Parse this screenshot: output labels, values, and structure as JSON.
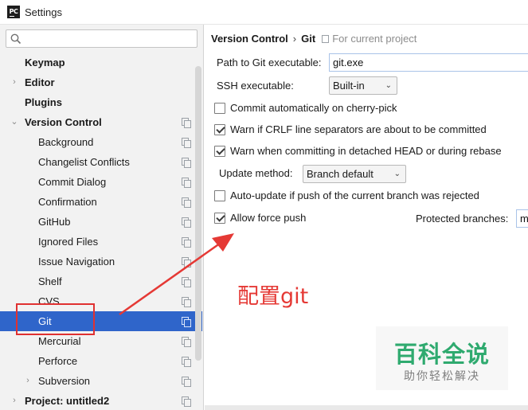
{
  "window": {
    "title": "Settings",
    "app_icon_text": "PC"
  },
  "search": {
    "placeholder": ""
  },
  "tree": [
    {
      "label": "Keymap",
      "bold": true,
      "arrow": "",
      "indent": 0,
      "copy": false,
      "selected": false
    },
    {
      "label": "Editor",
      "bold": true,
      "arrow": "›",
      "indent": 0,
      "copy": false,
      "selected": false
    },
    {
      "label": "Plugins",
      "bold": true,
      "arrow": "",
      "indent": 0,
      "copy": false,
      "selected": false
    },
    {
      "label": "Version Control",
      "bold": true,
      "arrow": "⌄",
      "indent": 0,
      "copy": true,
      "selected": false
    },
    {
      "label": "Background",
      "bold": false,
      "arrow": "",
      "indent": 1,
      "copy": true,
      "selected": false
    },
    {
      "label": "Changelist Conflicts",
      "bold": false,
      "arrow": "",
      "indent": 1,
      "copy": true,
      "selected": false
    },
    {
      "label": "Commit Dialog",
      "bold": false,
      "arrow": "",
      "indent": 1,
      "copy": true,
      "selected": false
    },
    {
      "label": "Confirmation",
      "bold": false,
      "arrow": "",
      "indent": 1,
      "copy": true,
      "selected": false
    },
    {
      "label": "GitHub",
      "bold": false,
      "arrow": "",
      "indent": 1,
      "copy": true,
      "selected": false
    },
    {
      "label": "Ignored Files",
      "bold": false,
      "arrow": "",
      "indent": 1,
      "copy": true,
      "selected": false
    },
    {
      "label": "Issue Navigation",
      "bold": false,
      "arrow": "",
      "indent": 1,
      "copy": true,
      "selected": false
    },
    {
      "label": "Shelf",
      "bold": false,
      "arrow": "",
      "indent": 1,
      "copy": true,
      "selected": false
    },
    {
      "label": "CVS",
      "bold": false,
      "arrow": "",
      "indent": 1,
      "copy": true,
      "selected": false
    },
    {
      "label": "Git",
      "bold": false,
      "arrow": "",
      "indent": 1,
      "copy": true,
      "selected": true
    },
    {
      "label": "Mercurial",
      "bold": false,
      "arrow": "",
      "indent": 1,
      "copy": true,
      "selected": false
    },
    {
      "label": "Perforce",
      "bold": false,
      "arrow": "",
      "indent": 1,
      "copy": true,
      "selected": false
    },
    {
      "label": "Subversion",
      "bold": false,
      "arrow": "›",
      "indent": 1,
      "copy": true,
      "selected": false
    },
    {
      "label": "Project: untitled2",
      "bold": true,
      "arrow": "›",
      "indent": 0,
      "copy": true,
      "selected": false
    }
  ],
  "breadcrumb": {
    "section": "Version Control",
    "separator": "›",
    "page": "Git",
    "scope": "For current project"
  },
  "settings": {
    "git_path_label": "Path to Git executable:",
    "git_path_value": "git.exe",
    "ssh_label": "SSH executable:",
    "ssh_value": "Built-in",
    "commit_cherry_pick": {
      "label": "Commit automatically on cherry-pick",
      "checked": false
    },
    "warn_crlf": {
      "label": "Warn if CRLF line separators are about to be committed",
      "checked": true
    },
    "warn_detached": {
      "label": "Warn when committing in detached HEAD or during rebase",
      "checked": true
    },
    "update_method_label": "Update method:",
    "update_method_value": "Branch default",
    "auto_update": {
      "label": "Auto-update if push of the current branch was rejected",
      "checked": false
    },
    "allow_force_push": {
      "label": "Allow force push",
      "checked": true
    },
    "protected_branches_label": "Protected branches:",
    "protected_branches_value": "m"
  },
  "annotation": {
    "text": "配置git",
    "color": "#e53935"
  },
  "watermark": {
    "title": "百科全说",
    "subtitle": "助你轻松解决"
  },
  "colors": {
    "selection": "#2f65ca",
    "annotation": "#e53935",
    "watermark": "#27a76a"
  }
}
